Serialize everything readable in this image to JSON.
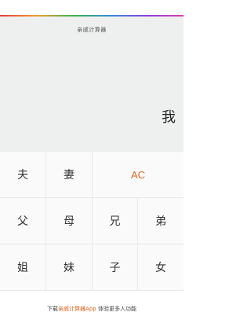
{
  "app": {
    "title": "亲戚计算器",
    "result": "我"
  },
  "keys": {
    "husband": "夫",
    "wife": "妻",
    "clear": "AC",
    "father": "父",
    "mother": "母",
    "older_brother": "兄",
    "younger_brother": "弟",
    "older_sister": "姐",
    "younger_sister": "妹",
    "son": "子",
    "daughter": "女"
  },
  "footer": {
    "prefix": "下载",
    "link": "亲戚计算器App",
    "suffix": " 体验更多人功能"
  },
  "colors": {
    "accent": "#e0641e",
    "display_bg": "#eef0ef"
  }
}
